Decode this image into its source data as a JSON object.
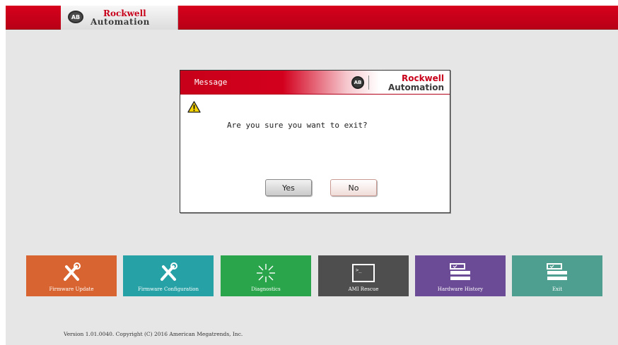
{
  "header": {
    "logo_badge": "AB",
    "brand_line1": "Rockwell",
    "brand_line2": "Automation"
  },
  "dialog": {
    "title": "Message",
    "logo_badge": "AB",
    "brand_line1": "Rockwell",
    "brand_line2": "Automation",
    "icon": "warning-icon",
    "message": "Are you sure you want to exit?",
    "yes_label": "Yes",
    "no_label": "No"
  },
  "tiles": [
    {
      "label": "Firmware Update",
      "icon": "tools-icon",
      "color": "#d86531"
    },
    {
      "label": "Firmware Configuration",
      "icon": "tools-icon",
      "color": "#26a1a6"
    },
    {
      "label": "Diagnostics",
      "icon": "starburst-icon",
      "color": "#2ba54b"
    },
    {
      "label": "AMI Rescue",
      "icon": "terminal-icon",
      "color": "#4e4e4e"
    },
    {
      "label": "Hardware History",
      "icon": "form-icon",
      "color": "#6c4b96"
    },
    {
      "label": "Exit",
      "icon": "form-icon",
      "color": "#4f9f91"
    }
  ],
  "footer": {
    "text": "Version 1.01.0040. Copyright (C) 2016 American Megatrends, Inc."
  }
}
